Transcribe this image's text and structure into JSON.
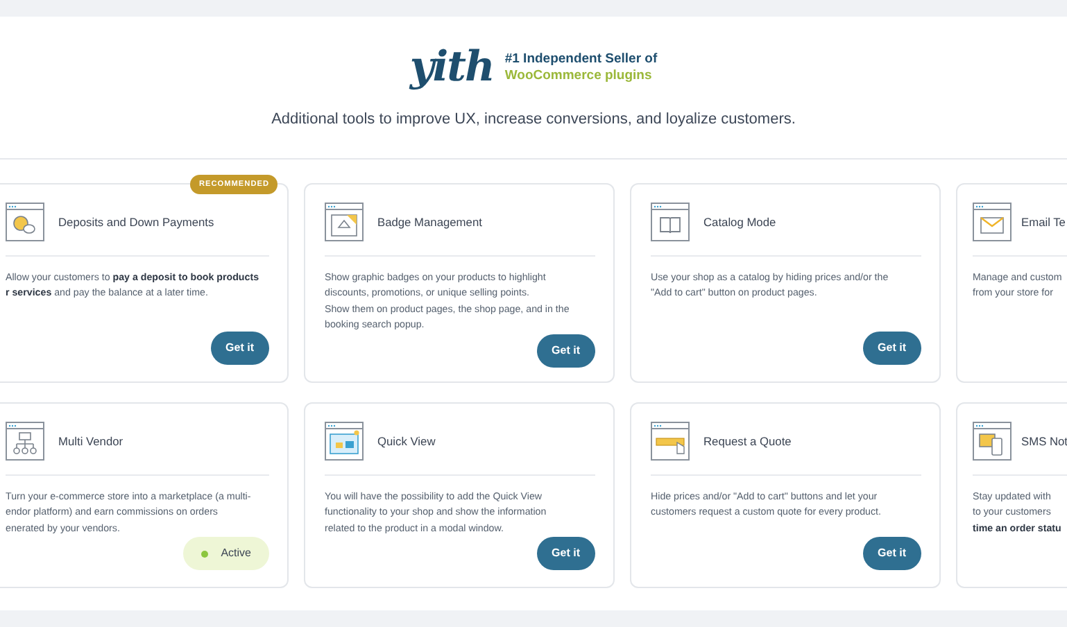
{
  "header": {
    "logo": "yith",
    "tagline_top": "#1 Independent Seller of",
    "tagline_bottom": "WooCommerce plugins",
    "subtitle": "Additional tools to improve UX, increase conversions, and loyalize customers."
  },
  "cards": [
    {
      "title": "Deposits and Down Payments",
      "badge": "RECOMMENDED",
      "description": "Allow your customers to **pay a deposit to book products**\n**r services** and pay the balance at a later time.",
      "action": {
        "kind": "button",
        "label": "Get it"
      }
    },
    {
      "title": "Badge Management",
      "description": "Show graphic badges on your products to highlight\ndiscounts, promotions, or unique selling points.\nShow them on product pages, the shop page, and in the\nbooking search popup.",
      "action": {
        "kind": "button",
        "label": "Get it"
      }
    },
    {
      "title": "Catalog Mode",
      "description": "Use your shop as a catalog by hiding prices and/or the\n\"Add to cart\" button on product pages.",
      "action": {
        "kind": "button",
        "label": "Get it"
      }
    },
    {
      "title": "Email Te",
      "description": "Manage and custom\nfrom your store for"
    },
    {
      "title": "Multi Vendor",
      "description": "Turn your e-commerce store into a marketplace (a multi-\nendor platform) and earn commissions on orders\nenerated by your vendors.",
      "action": {
        "kind": "status",
        "label": "Active"
      }
    },
    {
      "title": "Quick View",
      "description": "You will have the possibility to add the Quick View\nfunctionality to your shop and show the information\nrelated to the product in a modal window.",
      "action": {
        "kind": "button",
        "label": "Get it"
      }
    },
    {
      "title": "Request a Quote",
      "description": "Hide prices and/or \"Add to cart\" buttons and let your\ncustomers request a custom quote for every product.",
      "action": {
        "kind": "button",
        "label": "Get it"
      }
    },
    {
      "title": "SMS Not",
      "description": "Stay updated with\nto your customers\n**time an order statu**"
    }
  ]
}
